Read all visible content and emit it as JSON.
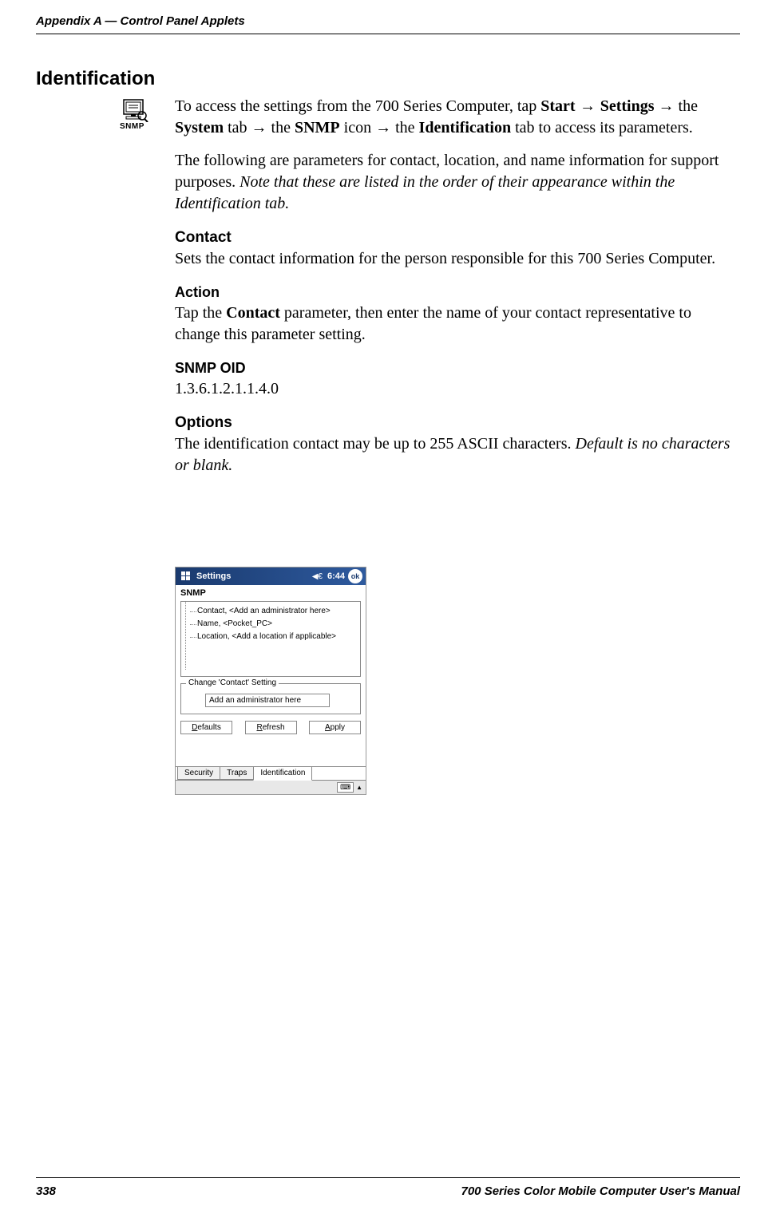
{
  "header": {
    "left": "Appendix  A    —   Control Panel Applets"
  },
  "section_title": "Identification",
  "snmp_icon_label": "SNMP",
  "intro": {
    "p1_pre": "To access the settings from the 700 Series Computer, tap ",
    "p1_start": "Start",
    "p1_arrow": " → ",
    "p1_settings": "Settings",
    "p1_mid1": " → the ",
    "p1_system": "System",
    "p1_mid2": " tab → the ",
    "p1_snmp": "SNMP",
    "p1_mid3": " icon → the ",
    "p1_ident": "Identification",
    "p1_post": " tab to access its parameters.",
    "p2_pre": "The following are parameters for contact, location, and name information for support purposes. ",
    "p2_italic": "Note that these are listed in the order of their appearance within the Identification tab."
  },
  "contact": {
    "title": "Contact",
    "body": "Sets the contact information for the person responsible for this 700 Series Computer."
  },
  "action": {
    "title": "Action",
    "body_pre": "Tap the ",
    "body_bold": "Contact",
    "body_post": " parameter, then enter the name of your contact representative to change this parameter setting."
  },
  "snmp_oid": {
    "title": "SNMP OID",
    "value": "1.3.6.1.2.1.1.4.0"
  },
  "options": {
    "title": "Options",
    "body_pre": "The identification contact may be up to 255 ASCII characters. ",
    "body_italic": "Default is no characters or blank."
  },
  "pda": {
    "title": "Settings",
    "time": "6:44",
    "ok": "ok",
    "app_title": "SNMP",
    "tree": {
      "contact": "Contact, <Add an administrator here>",
      "name": "Name, <Pocket_PC>",
      "location": "Location, <Add a location if applicable>"
    },
    "fieldset_legend": "Change 'Contact' Setting",
    "input_value": "Add an administrator here",
    "buttons": {
      "defaults": "Defaults",
      "refresh": "Refresh",
      "apply": "Apply"
    },
    "tabs": {
      "security": "Security",
      "traps": "Traps",
      "identification": "Identification"
    }
  },
  "footer": {
    "page": "338",
    "right": "700 Series Color Mobile Computer User's Manual"
  }
}
